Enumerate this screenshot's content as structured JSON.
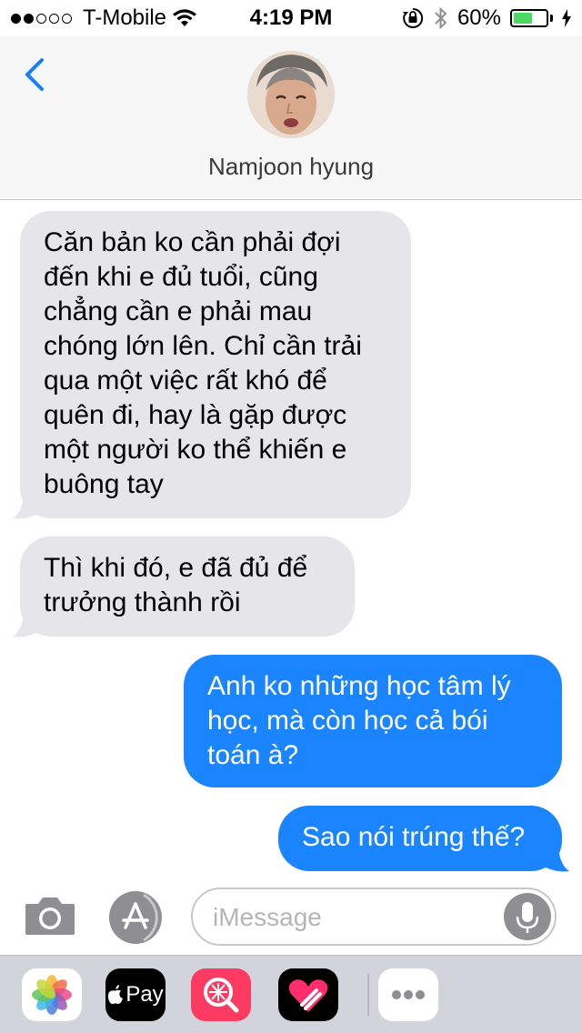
{
  "status_bar": {
    "carrier": "T-Mobile",
    "time": "4:19 PM",
    "battery_percent_label": "60%",
    "battery_level": 0.6,
    "signal_bars_filled": 2,
    "signal_bars_total": 5,
    "icons": [
      "wifi-icon",
      "orientation-lock-icon",
      "bluetooth-icon",
      "battery-icon",
      "charging-bolt-icon"
    ]
  },
  "header": {
    "contact_name": "Namjoon hyung",
    "back_icon": "chevron-left-icon"
  },
  "messages": [
    {
      "direction": "incoming",
      "text": "Căn bản ko cần phải đợi\nđến khi e đủ tuổi, cũng\nchẳng cần e phải mau\nchóng lớn lên. Chỉ cần trải\nqua một việc rất khó để\nquên đi, hay là gặp được\nmột người ko thể khiến e\nbuông tay"
    },
    {
      "direction": "incoming",
      "text": "Thì khi đó, e đã đủ để\ntrưởng thành rồi"
    },
    {
      "direction": "outgoing",
      "text": "Anh ko những học tâm lý\nhọc, mà còn học cả bói\ntoán à?"
    },
    {
      "direction": "outgoing",
      "text": "Sao nói trúng thế?"
    }
  ],
  "input_bar": {
    "placeholder": "iMessage",
    "camera_icon": "camera-icon",
    "apps_icon": "app-store-icon",
    "mic_icon": "microphone-icon"
  },
  "app_drawer": {
    "apps": [
      "photos-icon",
      "apple-pay-icon",
      "search-images-icon",
      "digital-touch-icon",
      "more-icon"
    ],
    "apple_pay_label": "Pay"
  },
  "colors": {
    "incoming_bubble": "#e5e5ea",
    "outgoing_bubble": "#1a85ff",
    "accent": "#147efb",
    "battery_fill": "#4cd964"
  }
}
